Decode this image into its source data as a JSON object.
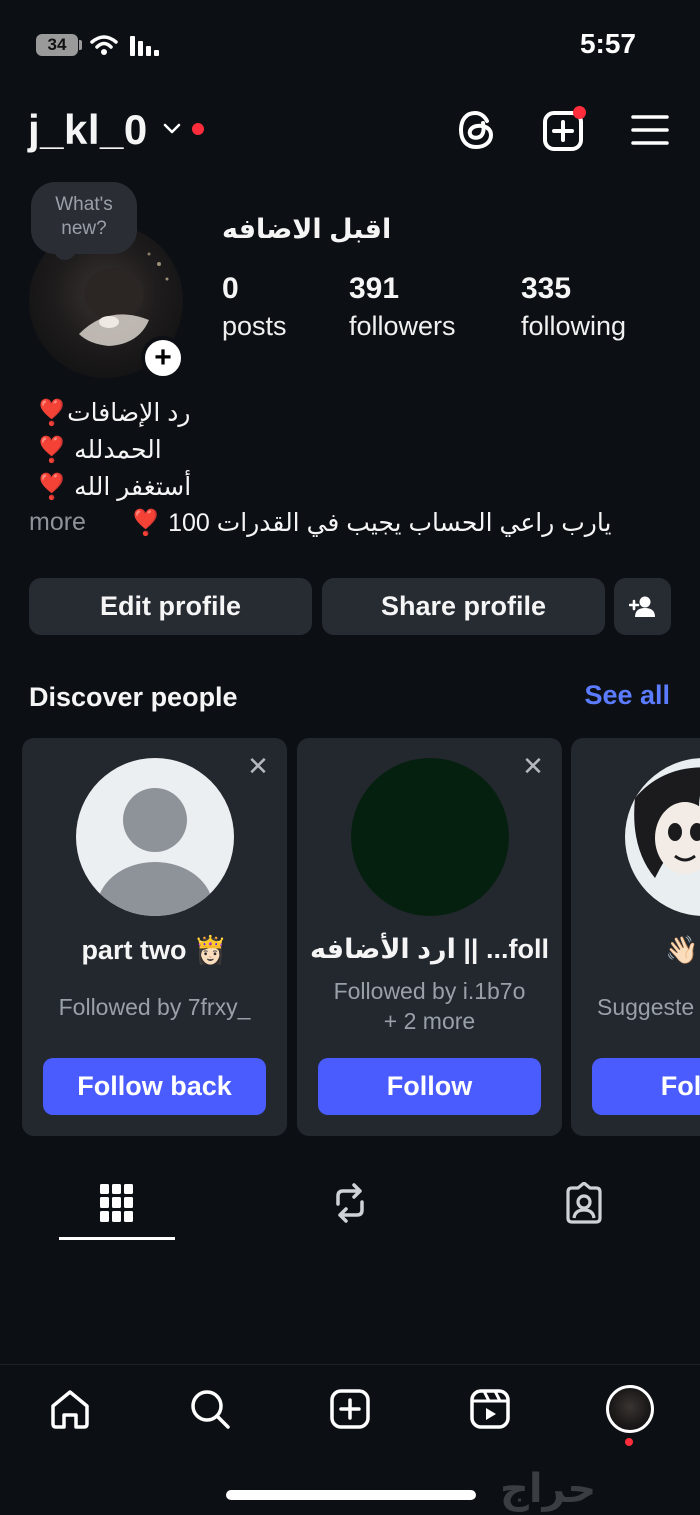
{
  "status_bar": {
    "battery": "34",
    "time": "5:57"
  },
  "header": {
    "username": "j_kl_0",
    "icons": [
      "chevron-down-icon",
      "threads-icon",
      "create-icon",
      "menu-icon"
    ]
  },
  "profile": {
    "note_bubble": "What's new?",
    "display_name": "اقبل الاضافه",
    "stats": [
      {
        "value": "0",
        "label": "posts"
      },
      {
        "value": "391",
        "label": "followers"
      },
      {
        "value": "335",
        "label": "following"
      }
    ],
    "bio_lines": [
      "رد الإضافات❣️",
      "الحمدلله ❣️",
      "أستغفر الله ❣️",
      "يارب راعي الحساب يجيب في القدرات 100 ❣️"
    ],
    "more_label": "more"
  },
  "actions": {
    "edit_profile": "Edit profile",
    "share_profile": "Share profile"
  },
  "discover": {
    "title": "Discover people",
    "see_all": "See all",
    "cards": [
      {
        "name": "part two 👸🏻",
        "sub1": "Followed by 7frxy_",
        "sub2": "",
        "button": "Follow back"
      },
      {
        "name": "ارد الأضافه || ...foll",
        "sub1": "Followed by i.1b7o",
        "sub2": "+ 2 more",
        "button": "Follow"
      },
      {
        "name": "👋🏻",
        "sub1": "Suggeste",
        "sub2": "",
        "button": "Follow"
      }
    ]
  },
  "content_tabs": [
    "grid-icon",
    "reposts-icon",
    "tagged-icon"
  ],
  "bottom_nav": [
    "home-icon",
    "search-icon",
    "create-icon",
    "reels-icon",
    "profile-avatar"
  ],
  "watermark": "حراج",
  "colors": {
    "background": "#0c0f14",
    "button": "#272b32",
    "card": "#23272e",
    "accent": "#4b5cff",
    "link": "#5b7cff",
    "notification": "#ff2d3b"
  }
}
